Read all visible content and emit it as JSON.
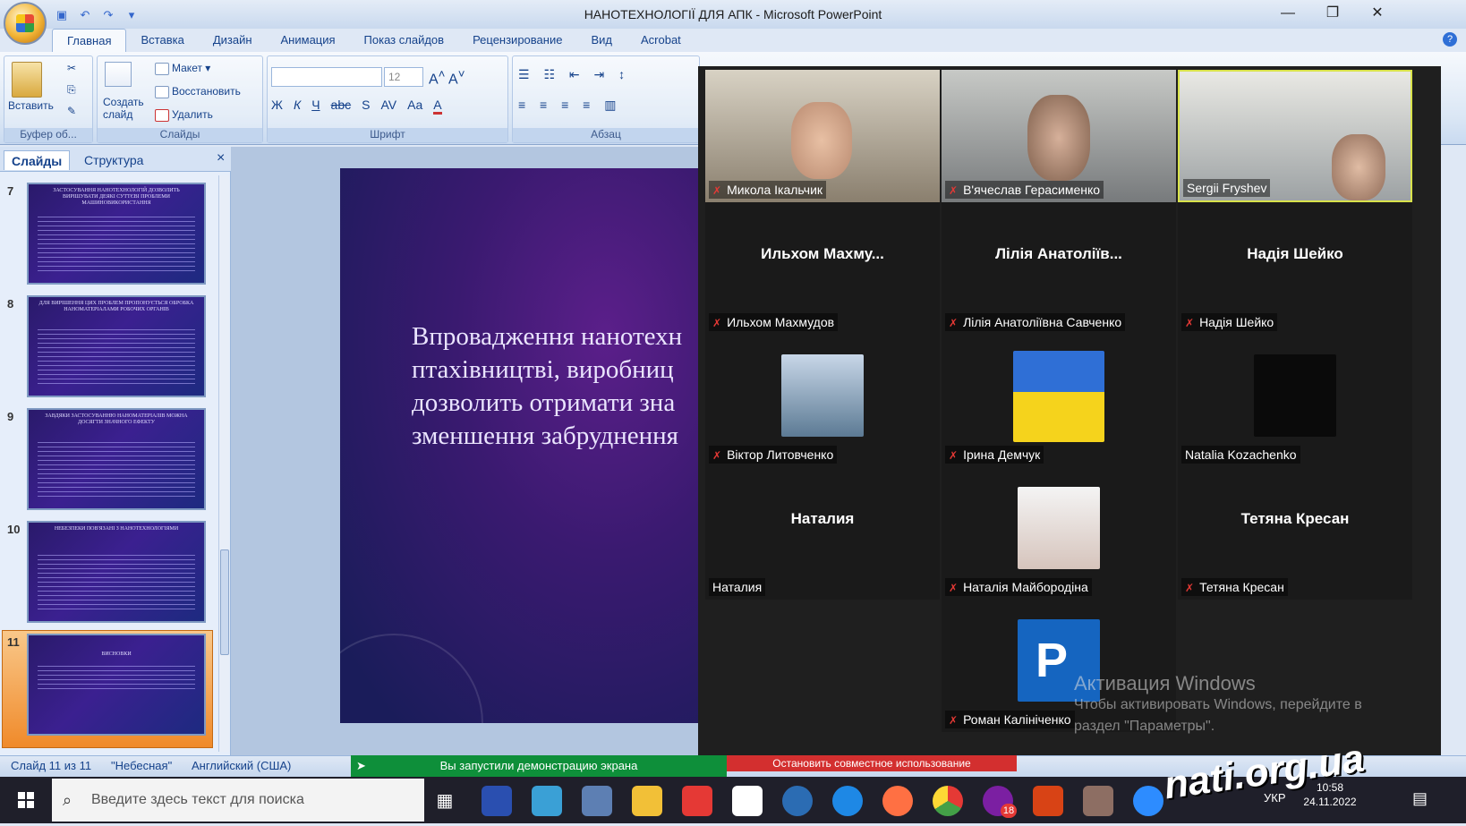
{
  "titlebar": {
    "title": "НАНОТЕХНОЛОГІЇ ДЛЯ АПК - Microsoft PowerPoint",
    "minimize": "—",
    "restore": "❐",
    "close": "✕"
  },
  "ribbon": {
    "tabs": [
      "Главная",
      "Вставка",
      "Дизайн",
      "Анимация",
      "Показ слайдов",
      "Рецензирование",
      "Вид",
      "Acrobat"
    ],
    "paste": "Вставить",
    "create_slide": "Создать слайд",
    "layout": "Макет",
    "restore": "Восстановить",
    "delete": "Удалить",
    "font_size": "12",
    "groups": {
      "clipboard": "Буфер об...",
      "slides": "Слайды",
      "font": "Шрифт",
      "paragraph": "Абзац"
    },
    "font_buttons": [
      "Ж",
      "К",
      "Ч",
      "abc",
      "S",
      "AV",
      "Aa",
      "A"
    ]
  },
  "left_panel": {
    "tabs": [
      "Слайды",
      "Структура"
    ],
    "close": "×",
    "slides": [
      {
        "num": "7",
        "title": "ЗАСТОСУВАННЯ НАНОТЕХНОЛОГІЙ ДОЗВОЛИТЬ ВИРІШУВАТИ ДЕЯКІ СУТТЄВІ ПРОБЛЕМИ МАШИНОВИКОРИСТАННЯ"
      },
      {
        "num": "8",
        "title": "ДЛЯ ВИРІШЕННЯ ЦИХ ПРОБЛЕМ ПРОПОНУЄТЬСЯ ОБРОБКА НАНОМАТЕРІАЛАМИ РОБОЧИХ ОРГАНІВ"
      },
      {
        "num": "9",
        "title": "ЗАВДЯКИ ЗАСТОСУВАННЮ НАНОМАТЕРІАЛІВ МОЖНА ДОСЯГТИ ЗНАЧНОГО ЕФЕКТУ"
      },
      {
        "num": "10",
        "title": "НЕБЕЗПЕКИ ПОВ'ЯЗАНІ З НАНОТЕХНОЛОГІЯМИ"
      },
      {
        "num": "11",
        "title": "ВИСНОВКИ"
      }
    ]
  },
  "slide": {
    "lines": [
      "Впровадження нанотехн",
      "птахівництві, виробниц",
      "дозволить отримати зна",
      "зменшення забруднення"
    ]
  },
  "zoom": {
    "tiles": [
      {
        "name": "Микола Ікальчик",
        "muted": true,
        "type": "video"
      },
      {
        "name": "В'ячеслав Герасименко",
        "muted": true,
        "type": "video"
      },
      {
        "name": "Sergii Fryshev",
        "muted": false,
        "type": "video"
      },
      {
        "big": "Ильхом  Махму...",
        "name": "Ильхом Махмудов",
        "muted": true,
        "type": "text"
      },
      {
        "big": "Лілія  Анатоліїв...",
        "name": "Лілія Анатоліївна Савченко",
        "muted": true,
        "type": "text"
      },
      {
        "big": "Надія Шейко",
        "name": "Надія Шейко",
        "muted": true,
        "type": "text"
      },
      {
        "name": "Віктор Литовченко",
        "muted": true,
        "type": "photo"
      },
      {
        "name": "Ірина Демчук",
        "muted": true,
        "type": "photo"
      },
      {
        "name": "Natalia Kozachenko",
        "muted": false,
        "type": "black"
      },
      {
        "big": "Наталия",
        "name": "Наталия",
        "muted": false,
        "type": "text"
      },
      {
        "name": "Наталія Майбородіна",
        "muted": true,
        "type": "photo"
      },
      {
        "big": "Тетяна Кресан",
        "name": "Тетяна Кресан",
        "muted": true,
        "type": "text"
      },
      {
        "name": "Роман Калініченко",
        "muted": true,
        "type": "avatar",
        "initial": "Р"
      }
    ],
    "mic_icon": "✗"
  },
  "statusbar": {
    "slide_info": "Слайд 11 из 11",
    "theme": "\"Небесная\"",
    "language": "Английский (США)",
    "share_message": "Вы запустили демонстрацию экрана",
    "stop_share": "Остановить совместное использование"
  },
  "watermark": {
    "title": "Активация Windows",
    "line1": "Чтобы активировать Windows, перейдите в",
    "line2": "раздел \"Параметры\"."
  },
  "taskbar": {
    "search_placeholder": "Введите здесь текст для поиска",
    "lang": "УКР",
    "time": "10:58",
    "date": "24.11.2022",
    "badge": "18",
    "site": "nati.org.ua"
  },
  "colors": {
    "accent": "#15428b",
    "share_green": "#0e8f3a",
    "stop_red": "#d32f2f",
    "mic_red": "#e53935"
  }
}
